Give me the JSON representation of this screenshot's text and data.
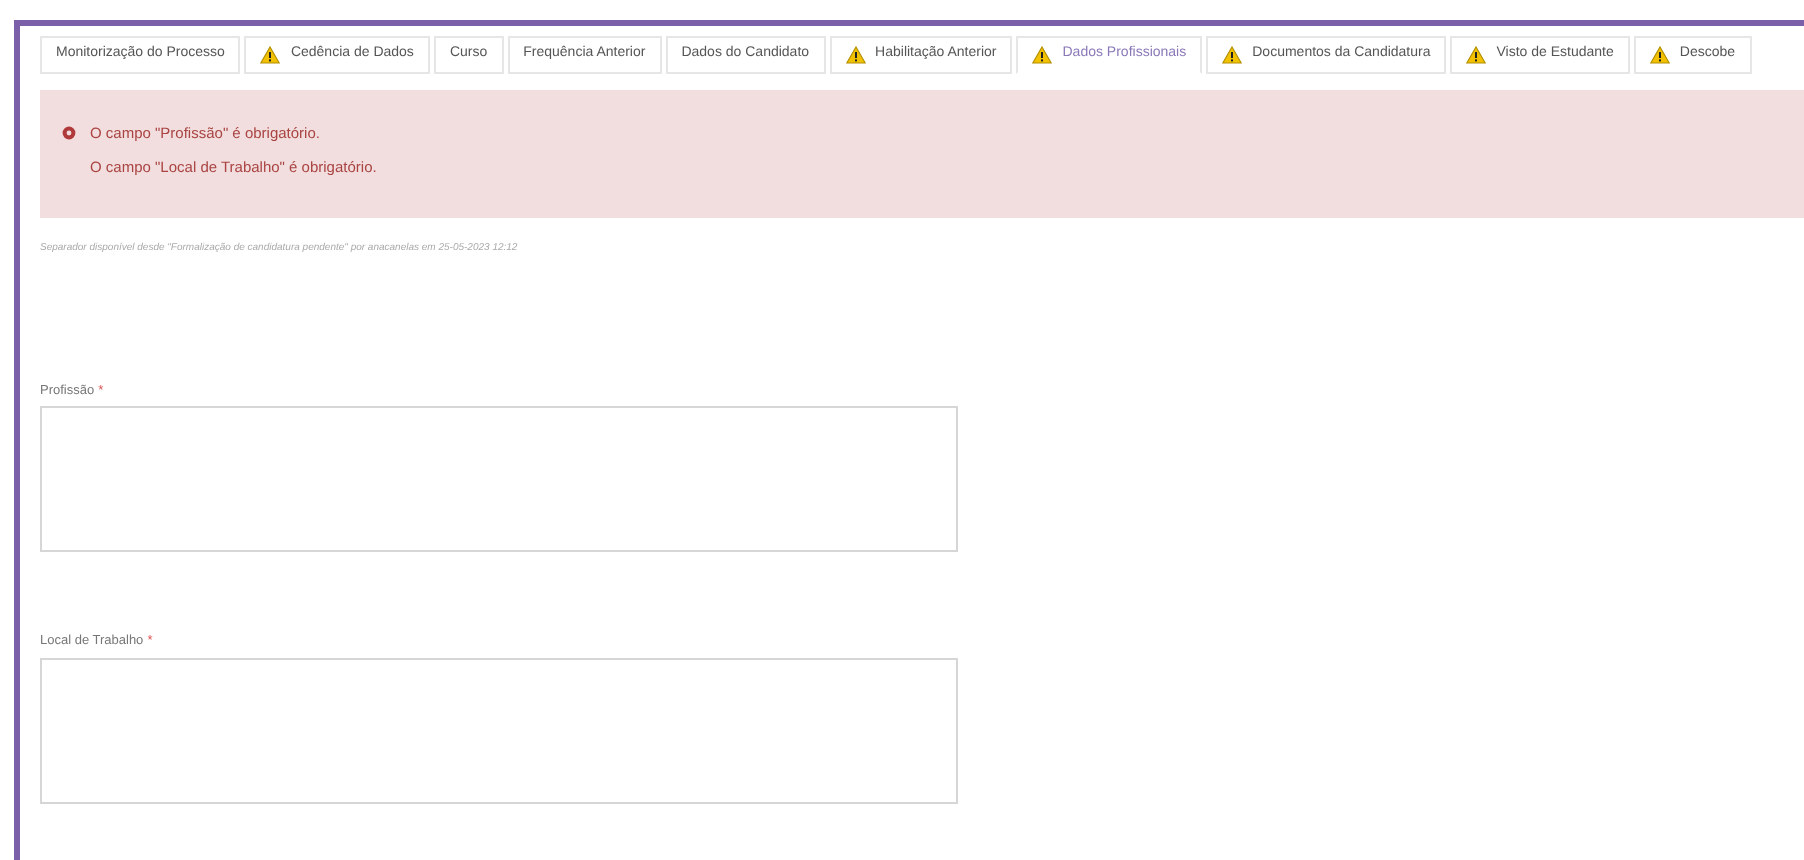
{
  "tabs": [
    {
      "label": "Monitorização do Processo",
      "warning": false,
      "selected": false
    },
    {
      "label": "Cedência de Dados",
      "warning": true,
      "selected": false
    },
    {
      "label": "Curso",
      "warning": false,
      "selected": false
    },
    {
      "label": "Frequência Anterior",
      "warning": false,
      "selected": false
    },
    {
      "label": "Dados do Candidato",
      "warning": false,
      "selected": false
    },
    {
      "label": "Habilitação Anterior",
      "warning": true,
      "selected": false
    },
    {
      "label": "Dados Profissionais",
      "warning": true,
      "selected": true
    },
    {
      "label": "Documentos da Candidatura",
      "warning": true,
      "selected": false
    },
    {
      "label": "Visto de Estudante",
      "warning": true,
      "selected": false
    },
    {
      "label": "Descobe",
      "warning": true,
      "selected": false
    }
  ],
  "errors": [
    {
      "text": "O campo \"Profissão\" é obrigatório.",
      "icon": true
    },
    {
      "text": "O campo \"Local de Trabalho\" é obrigatório.",
      "icon": false
    }
  ],
  "note": "Separador disponível desde \"Formalização de candidatura pendente\" por anacanelas em 25-05-2023 12:12",
  "fields": [
    {
      "label": "Profissão",
      "required_mark": "*"
    },
    {
      "label": "Local de Trabalho",
      "required_mark": "*"
    }
  ]
}
